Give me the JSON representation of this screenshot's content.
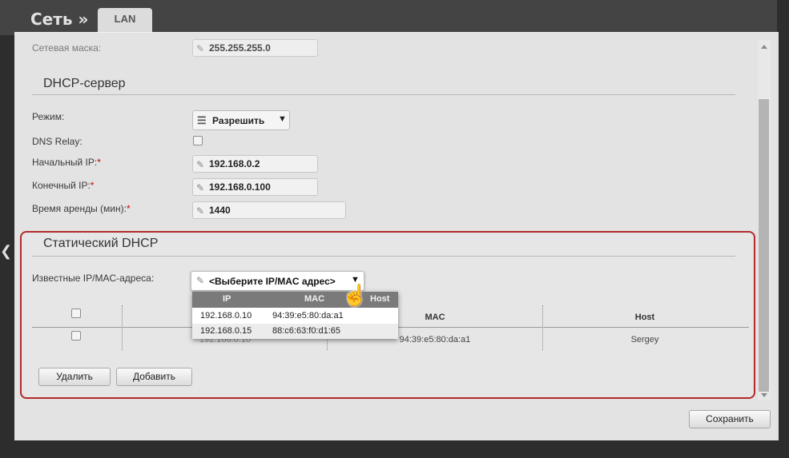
{
  "header": {
    "title": "Сеть »",
    "tab": "LAN"
  },
  "lan": {
    "netmask_label": "Сетевая маска:",
    "netmask_value": "255.255.255.0"
  },
  "dhcp": {
    "title": "DHCP-сервер",
    "mode_label": "Режим:",
    "mode_value": "Разрешить",
    "dns_relay_label": "DNS Relay:",
    "start_ip_label": "Начальный IP:",
    "start_ip_value": "192.168.0.2",
    "end_ip_label": "Конечный IP:",
    "end_ip_value": "192.168.0.100",
    "lease_label": "Время аренды (мин):",
    "lease_value": "1440",
    "required_mark": "*"
  },
  "static_dhcp": {
    "title": "Статический DHCP",
    "known_label": "Известные IP/MAC-адреса:",
    "select_value": "<Выберите IP/MAC адрес>",
    "columns": {
      "mac": "MAC",
      "host": "Host"
    },
    "row": {
      "ip": "192.168.0.10",
      "mac": "94:39:e5:80:da:a1",
      "host": "Sergey"
    },
    "dropdown": {
      "headers": {
        "ip": "IP",
        "mac": "MAC",
        "host": "Host"
      },
      "rows": [
        {
          "ip": "192.168.0.10",
          "mac": "94:39:e5:80:da:a1"
        },
        {
          "ip": "192.168.0.15",
          "mac": "88:c6:63:f0:d1:65"
        }
      ]
    },
    "delete_label": "Удалить",
    "add_label": "Добавить"
  },
  "save_label": "Сохранить",
  "colors": {
    "accent_border": "#b32a2a",
    "dropdown_header": "#7a7a7a",
    "topbar": "#444444"
  },
  "icons": [
    "pencil-icon",
    "list-icon",
    "dropdown-arrow-icon",
    "hand-cursor-icon",
    "back-arrow-icon"
  ]
}
